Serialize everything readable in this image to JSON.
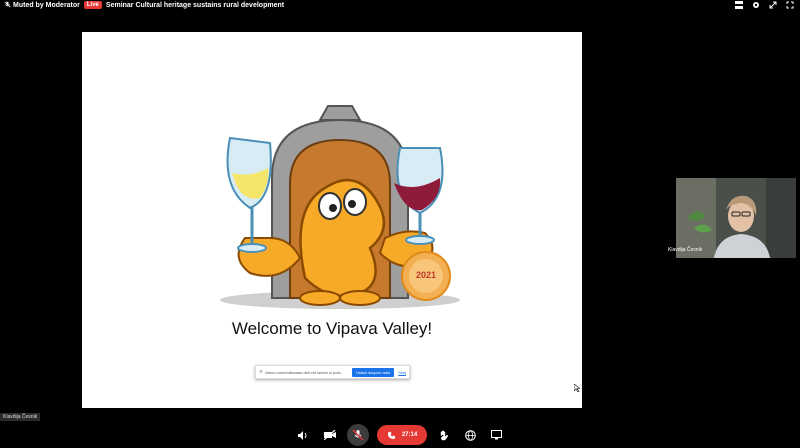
{
  "topbar": {
    "muted_label": "Muted by Moderator",
    "live_badge": "Live",
    "meeting_title": "Seminar Cultural heritage sustains rural development",
    "icons": [
      "grid-view-icon",
      "gear-icon",
      "collapse-icon",
      "fullscreen-icon"
    ]
  },
  "slide": {
    "welcome_text": "Welcome to Vipava Valley!",
    "badge_year": "2021",
    "screenshare_url": "vimeo.com/vviitamau.deli.vid sedon si pola",
    "stop_sharing_label": "Ustavi skupno rabo",
    "hide_label": "Skrij"
  },
  "participant": {
    "name": "Klavdija Česnik"
  },
  "self_label": "Klavdija Česnik",
  "toolbar": {
    "timer": "27:14",
    "end_call_color": "#e53935"
  },
  "colors": {
    "live": "#e53935",
    "accent": "#1a73e8"
  }
}
